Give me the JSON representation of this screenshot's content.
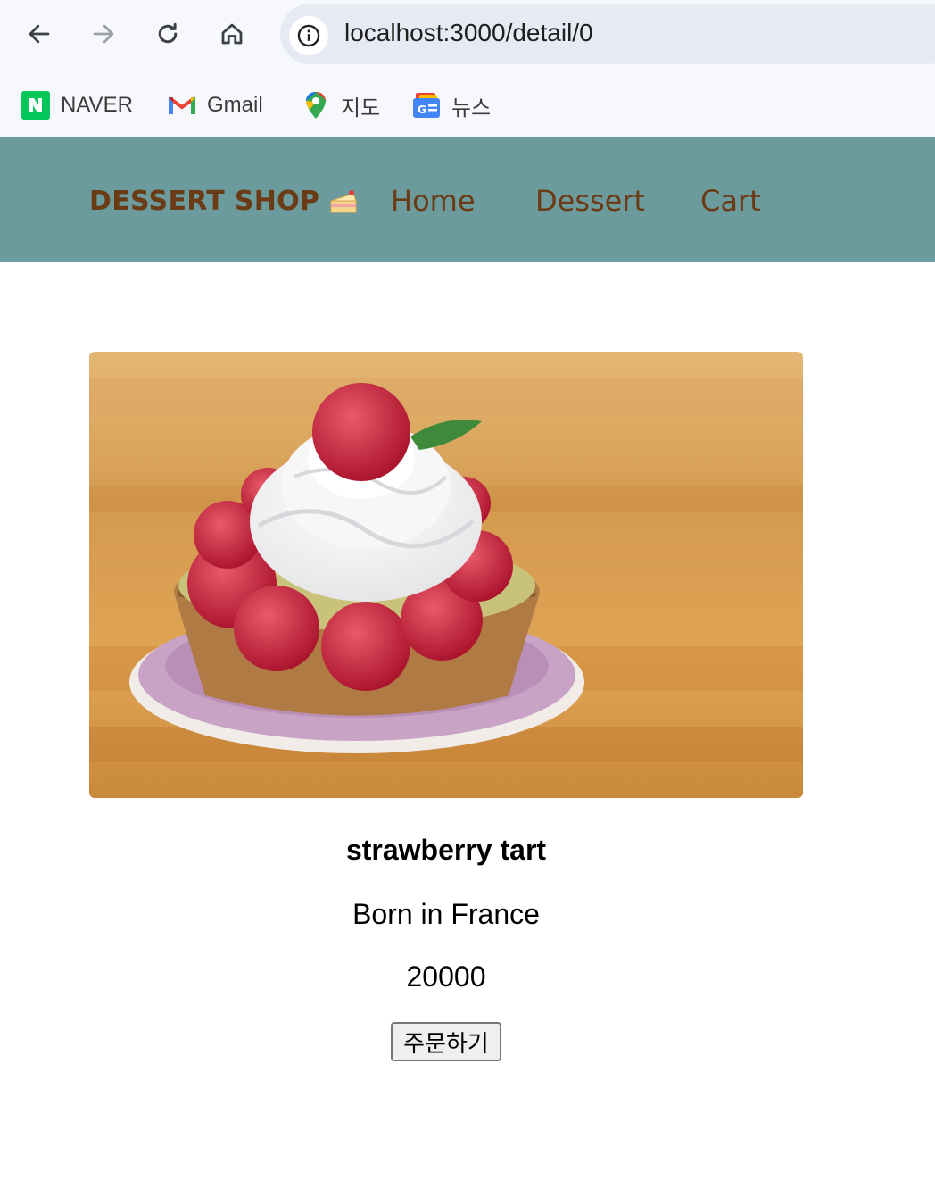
{
  "browser": {
    "url": "localhost:3000/detail/0",
    "bookmarks": [
      {
        "label": "NAVER",
        "icon": "naver-icon"
      },
      {
        "label": "Gmail",
        "icon": "gmail-icon"
      },
      {
        "label": "지도",
        "icon": "maps-icon"
      },
      {
        "label": "뉴스",
        "icon": "news-icon"
      }
    ]
  },
  "navbar": {
    "brand": "DESSERT SHOP",
    "brand_icon": "cake-icon",
    "links": [
      "Home",
      "Dessert",
      "Cart"
    ],
    "background": "#6c9b9d",
    "text_color": "#6a3b14"
  },
  "product": {
    "image": "strawberry-tart-photo",
    "title": "strawberry tart",
    "description": "Born in France",
    "price": "20000",
    "order_label": "주문하기"
  }
}
